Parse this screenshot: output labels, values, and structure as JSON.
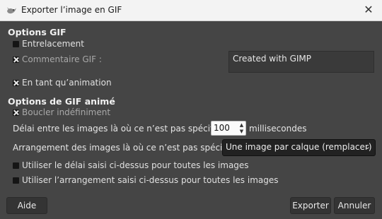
{
  "window": {
    "title": "Exporter l’image en GIF",
    "close_glyph": "✕"
  },
  "gif_options": {
    "heading": "Options GIF",
    "interlace_label": "Entrelacement",
    "interlace_checked": false,
    "comment_label": "Commentaire  GIF :",
    "comment_checked": true,
    "comment_value": "Created with GIMP",
    "as_animation_label": "En tant qu’animation",
    "as_animation_checked": true
  },
  "animated_options": {
    "heading": "Options de GIF animé",
    "loop_label": "Boucler indéfiniment",
    "loop_checked": true,
    "delay_label": "Délai entre les images là où ce n’est pas spécifié :",
    "delay_value": "100",
    "delay_unit": "millisecondes",
    "disposal_label": "Arrangement des images là où ce n’est pas spécifié :",
    "disposal_value": "Une image par calque (remplacer)",
    "use_delay_label": "Utiliser le délai saisi ci-dessus pour toutes les images",
    "use_delay_checked": false,
    "use_disposal_label": "Utiliser l’arrangement saisi ci-dessus pour toutes les images",
    "use_disposal_checked": false
  },
  "buttons": {
    "help": "Aide",
    "export": "Exporter",
    "cancel": "Annuler"
  },
  "colors": {
    "background": "#454545",
    "titlebar": "#f3f3f3"
  }
}
